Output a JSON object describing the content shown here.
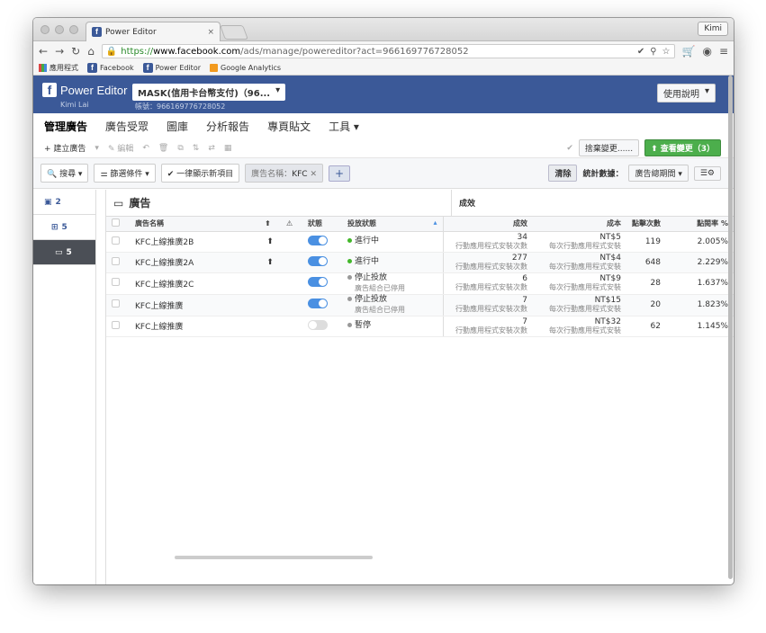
{
  "browser": {
    "tab_title": "Power Editor",
    "tab_close": "×",
    "user": "Kimi",
    "url_https": "https://",
    "url_host": "www.facebook.com",
    "url_path": "/ads/manage/powereditor?act=966169776728052",
    "bookmarks": [
      "應用程式",
      "Facebook",
      "Power Editor",
      "Google Analytics"
    ]
  },
  "fb": {
    "title": "Power Editor",
    "user": "Kimi Lai",
    "account": "MASK(信用卡台幣支付)（96...",
    "account_id": "帳號：966169776728052",
    "help": "使用說明"
  },
  "main_tabs": [
    "管理廣告",
    "廣告受眾",
    "圖庫",
    "分析報告",
    "專頁貼文",
    "工具 ▾"
  ],
  "toolbar1": {
    "create": "+ 建立廣告",
    "edit": "✎ 編輯",
    "discard": "捨棄變更......",
    "review": "⬆ 查看變更（3）"
  },
  "toolbar2": {
    "search": "🔍 搜尋 ▾",
    "filter": "⚌ 篩選條件 ▾",
    "always_show_new": "✔ 一律顯示新項目",
    "kfc_filter_label": "廣告名稱：",
    "kfc_filter_value": "KFC",
    "clear": "清除",
    "stats_label": "統計數據：",
    "stats_value": "廣告總期間 ▾"
  },
  "sidebar": [
    {
      "count": "2",
      "icon": "campaign-icon"
    },
    {
      "count": "5",
      "icon": "adset-icon"
    },
    {
      "count": "5",
      "icon": "ad-icon"
    }
  ],
  "table": {
    "section_left": "廣告",
    "section_right": "成效",
    "headers": [
      "廣告名稱",
      "狀態",
      "投放狀態",
      "成效",
      "成本",
      "點擊次數",
      "點閱率 %"
    ],
    "rows": [
      {
        "name": "KFC上線推廣2B",
        "on": true,
        "status": "進行中",
        "status_sub": "",
        "results": "34",
        "results_sub": "行動應用程式安裝次數",
        "cost": "NT$5",
        "cost_sub": "每次行動應用程式安裝",
        "clicks": "119",
        "ctr": "2.005%"
      },
      {
        "name": "KFC上線推廣2A",
        "on": true,
        "status": "進行中",
        "status_sub": "",
        "results": "277",
        "results_sub": "行動應用程式安裝次數",
        "cost": "NT$4",
        "cost_sub": "每次行動應用程式安裝",
        "clicks": "648",
        "ctr": "2.229%"
      },
      {
        "name": "KFC上線推廣2C",
        "on": true,
        "status": "停止投放",
        "status_sub": "廣告組合已停用",
        "results": "6",
        "results_sub": "行動應用程式安裝次數",
        "cost": "NT$9",
        "cost_sub": "每次行動應用程式安裝",
        "clicks": "28",
        "ctr": "1.637%"
      },
      {
        "name": "KFC上線推廣",
        "on": true,
        "status": "停止投放",
        "status_sub": "廣告組合已停用",
        "results": "7",
        "results_sub": "行動應用程式安裝次數",
        "cost": "NT$15",
        "cost_sub": "每次行動應用程式安裝",
        "clicks": "20",
        "ctr": "1.823%"
      },
      {
        "name": "KFC上線推廣",
        "on": false,
        "status": "暫停",
        "status_sub": "",
        "results": "7",
        "results_sub": "行動應用程式安裝次數",
        "cost": "NT$32",
        "cost_sub": "每次行動應用程式安裝",
        "clicks": "62",
        "ctr": "1.145%"
      }
    ]
  }
}
